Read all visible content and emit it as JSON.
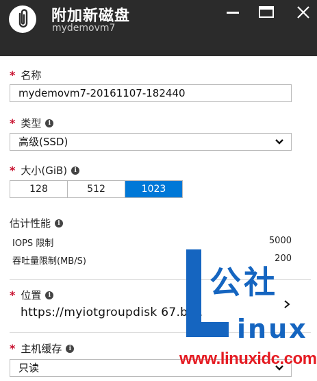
{
  "header": {
    "title": "附加新磁盘",
    "subtitle": "mydemovm7",
    "icon": "attachment-clip-icon",
    "buttons": [
      "minimize-icon",
      "maximize-icon",
      "close-icon"
    ]
  },
  "form": {
    "required_marker": "*",
    "info_glyph": "i",
    "name": {
      "label": "名称",
      "value": "mydemovm7-20161107-182440"
    },
    "type": {
      "label": "类型",
      "value": "高级(SSD)"
    },
    "size": {
      "label": "大小(GiB)",
      "options": [
        "128",
        "512",
        "1023"
      ],
      "selected": "1023"
    },
    "performance": {
      "label": "估计性能",
      "rows": [
        {
          "name": "IOPS 限制",
          "value": "5000"
        },
        {
          "name": "吞吐量限制(MB/S)",
          "value": "200"
        }
      ]
    },
    "location": {
      "label": "位置",
      "value": "https://myiotgroupdisk   67.bl..."
    },
    "cache": {
      "label": "主机缓存",
      "value": "只读"
    }
  },
  "watermark": {
    "brand_cn": "公社",
    "brand_en": "inux",
    "url": "www.linuxidc.com"
  },
  "colors": {
    "header_bg": "#2b2b2b",
    "accent": "#0078d7",
    "required": "#c8102e",
    "watermark_blue": "#1565c0",
    "watermark_red": "#e51c23"
  }
}
